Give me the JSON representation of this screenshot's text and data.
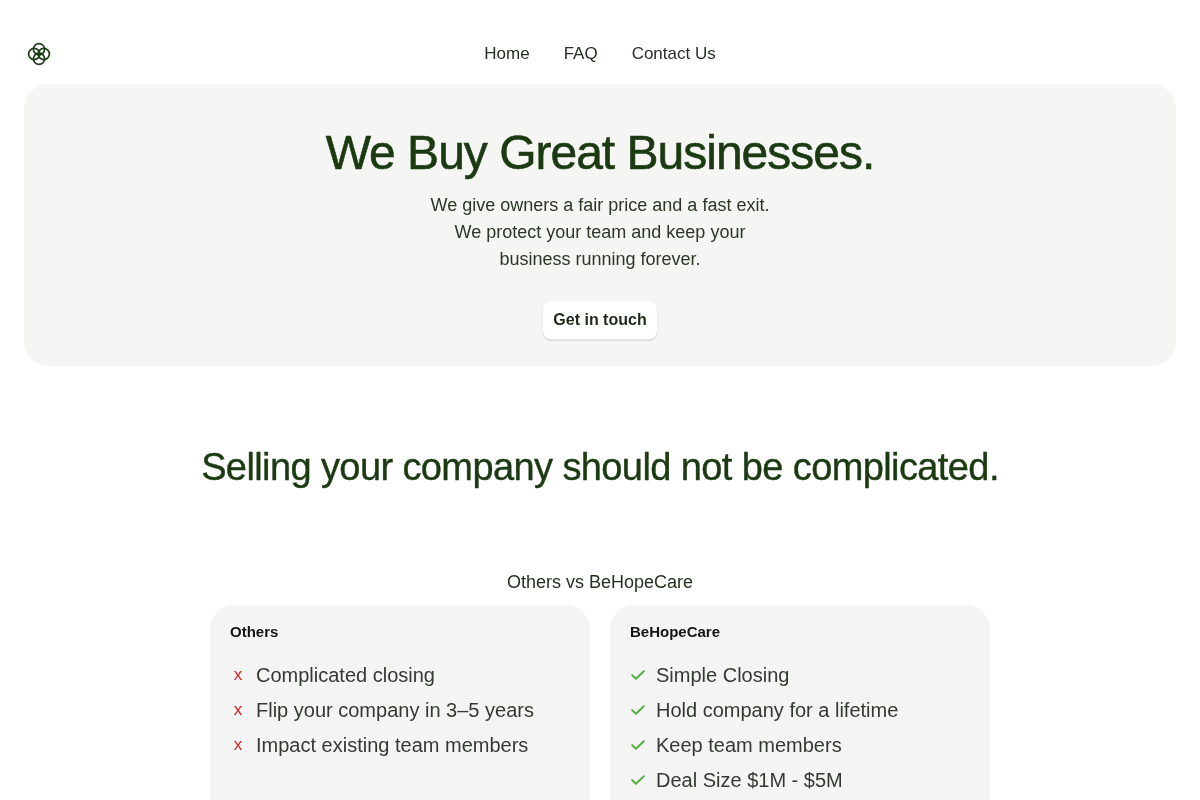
{
  "header": {
    "nav": [
      "Home",
      "FAQ",
      "Contact Us"
    ]
  },
  "hero": {
    "title": "We Buy Great Businesses.",
    "text": "We give owners a fair price and a fast exit. We protect your team and keep your business running forever.",
    "button": "Get in touch"
  },
  "comparison": {
    "heading": "Selling your company should not be complicated.",
    "subtitle": "Others vs BeHopeCare",
    "cards": [
      {
        "title": "Others",
        "items": [
          {
            "kind": "cross",
            "marker": "x",
            "text": "Complicated closing"
          },
          {
            "kind": "cross",
            "marker": "x",
            "text": "Flip your company in 3–5 years"
          },
          {
            "kind": "cross",
            "marker": "x",
            "text": "Impact existing team members"
          }
        ]
      },
      {
        "title": "BeHopeCare",
        "items": [
          {
            "kind": "check",
            "text": "Simple Closing"
          },
          {
            "kind": "check",
            "text": "Hold company for a lifetime"
          },
          {
            "kind": "check",
            "text": "Keep team members"
          },
          {
            "kind": "check",
            "text": "Deal Size $1M - $5M"
          }
        ]
      }
    ]
  }
}
